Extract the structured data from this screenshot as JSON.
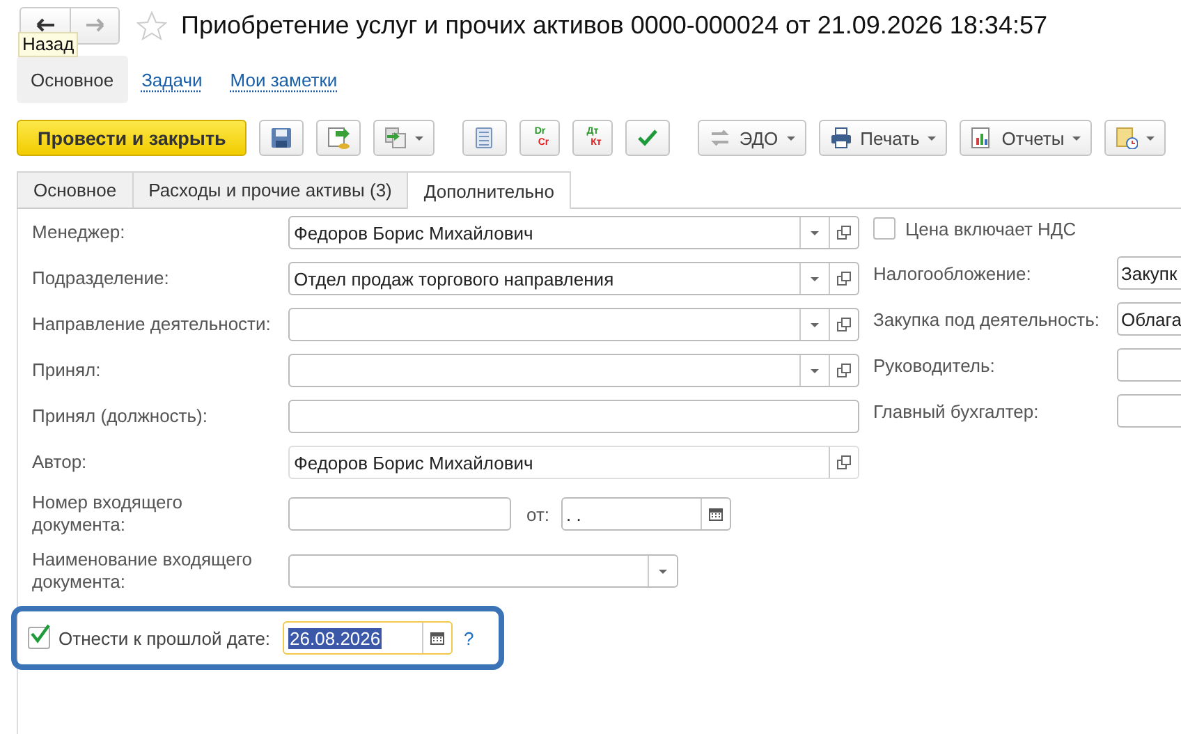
{
  "window": {
    "title": "Приобретение услуг и прочих активов 0000-000024 от 21.09.2026 18:34:57",
    "tooltip": "Назад"
  },
  "sections": [
    {
      "label": "Основное",
      "selected": true
    },
    {
      "label": "Задачи",
      "selected": false
    },
    {
      "label": "Мои заметки",
      "selected": false
    }
  ],
  "toolbar": [
    {
      "kind": "primary",
      "label": "Провести и закрыть"
    },
    {
      "kind": "icon",
      "dropdown": false
    },
    {
      "kind": "icon",
      "dropdown": false
    },
    {
      "kind": "icon",
      "dropdown": true
    },
    {
      "kind": "icon",
      "dropdown": false
    },
    {
      "kind": "text_icon",
      "top": "Dr",
      "bottom": "Cr",
      "dropdown": false
    },
    {
      "kind": "text_icon",
      "top": "Дт",
      "bottom": "Кт",
      "dropdown": false
    },
    {
      "kind": "icon",
      "dropdown": false
    },
    {
      "kind": "menu",
      "label": "ЭДО",
      "dropdown": true
    },
    {
      "kind": "menu",
      "label": "Печать",
      "dropdown": true
    },
    {
      "kind": "menu",
      "label": "Отчеты",
      "dropdown": true
    },
    {
      "kind": "icon",
      "dropdown": true
    }
  ],
  "tabs": [
    {
      "label": "Основное",
      "selected": false
    },
    {
      "label": "Расходы и прочие активы (3)",
      "selected": false
    },
    {
      "label": "Дополнительно",
      "selected": true
    }
  ],
  "left_fields": [
    {
      "kind": "combo",
      "label": "Менеджер:",
      "value": "Федоров Борис Михайлович"
    },
    {
      "kind": "combo",
      "label": "Подразделение:",
      "value": "Отдел продаж торгового направления"
    },
    {
      "kind": "combo",
      "label": "Направление деятельности:"
    },
    {
      "kind": "combo",
      "label": "Принял:"
    },
    {
      "kind": "text",
      "label": "Принял (должность):"
    },
    {
      "kind": "ref",
      "label": "Автор:",
      "value": "Федоров Борис Михайлович"
    },
    {
      "kind": "number_date",
      "label": "Номер входящего документа:",
      "date_label": "от:",
      "date_value": ".  ."
    },
    {
      "kind": "select",
      "label": "Наименование входящего документа:"
    }
  ],
  "past_date": {
    "checked": true,
    "label": "Отнести к прошлой дате:",
    "value": "26.08.2026",
    "help": "?"
  },
  "price_includes_vat": {
    "label": "Цена включает НДС",
    "checked": false
  },
  "right_fields": [
    {
      "label": "Налогообложение:",
      "value": "Закупк"
    },
    {
      "label": "Закупка под деятельность:",
      "value": "Облага"
    },
    {
      "label": "Руководитель:"
    },
    {
      "label": "Главный бухгалтер:"
    }
  ]
}
